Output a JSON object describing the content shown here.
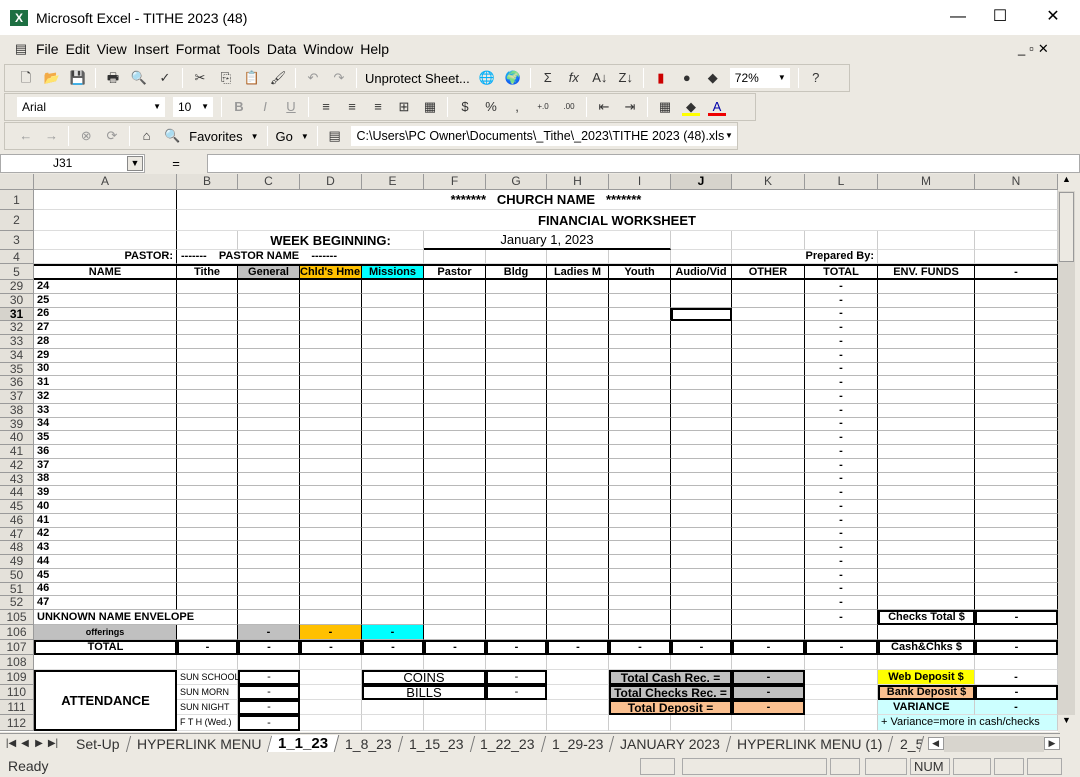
{
  "window": {
    "title": "Microsoft Excel - TITHE 2023 (48)",
    "minimize": "—",
    "maximize": "☐",
    "close": "✕"
  },
  "menu": {
    "items": [
      "File",
      "Edit",
      "View",
      "Insert",
      "Format",
      "Tools",
      "Data",
      "Window",
      "Help"
    ]
  },
  "toolbar": {
    "unprotect_label": "Unprotect Sheet...",
    "zoom": "72%",
    "font": "Arial",
    "font_size": "10",
    "favorites_label": "Favorites",
    "go_label": "Go",
    "address": "C:\\Users\\PC Owner\\Documents\\_Tithe\\_2023\\TITHE 2023 (48).xls"
  },
  "formula_bar": {
    "name_box": "J31",
    "fx": "=",
    "value": ""
  },
  "colors": {
    "gray": "#c0c0c0",
    "orange": "#ffc000",
    "cyan": "#00ffff",
    "yellow": "#ffff00",
    "peach": "#fac090",
    "light_cyan": "#ccffff"
  },
  "sheet": {
    "columns": [
      "A",
      "B",
      "C",
      "D",
      "E",
      "F",
      "G",
      "H",
      "I",
      "J",
      "K",
      "L",
      "M",
      "N"
    ],
    "row_numbers": [
      "1",
      "2",
      "3",
      "4",
      "5",
      "29",
      "30",
      "31",
      "32",
      "33",
      "34",
      "35",
      "36",
      "37",
      "38",
      "39",
      "40",
      "41",
      "42",
      "43",
      "44",
      "45",
      "46",
      "47",
      "48",
      "49",
      "50",
      "51",
      "52",
      "105",
      "106",
      "107",
      "108",
      "109",
      "110",
      "111",
      "112"
    ],
    "selected_cell": "J31",
    "cells": {
      "B1": "*******   CHURCH NAME   *******",
      "B2": "FINANCIAL WORKSHEET",
      "C3": "WEEK BEGINNING:",
      "F3": "January 1, 2023",
      "A4": "PASTOR:",
      "B4": "-------    PASTOR NAME    -------",
      "K4": "Prepared By:",
      "A5": "NAME",
      "B5": "Tithe",
      "C5": "General",
      "D5": "Chld's Hme",
      "E5": "Missions",
      "F5": "Pastor",
      "G5": "Bldg",
      "H5": "Ladies M",
      "I5": "Youth",
      "J5": "Audio/Vid",
      "K5": "OTHER",
      "L5": "TOTAL",
      "M5": "ENV. FUNDS",
      "N5": "-",
      "A29": "24",
      "A30": "25",
      "A31": "26",
      "A32": "27",
      "A33": "28",
      "A34": "29",
      "A35": "30",
      "A36": "31",
      "A37": "32",
      "A38": "33",
      "A39": "34",
      "A40": "35",
      "A41": "36",
      "A42": "37",
      "A43": "38",
      "A44": "39",
      "A45": "40",
      "A46": "41",
      "A47": "42",
      "A48": "43",
      "A49": "44",
      "A50": "45",
      "A51": "46",
      "A52": "47",
      "L29": "-",
      "L30": "-",
      "L31": "-",
      "L32": "-",
      "L33": "-",
      "L34": "-",
      "L35": "-",
      "L36": "-",
      "L37": "-",
      "L38": "-",
      "L39": "-",
      "L40": "-",
      "L41": "-",
      "L42": "-",
      "L43": "-",
      "L44": "-",
      "L45": "-",
      "L46": "-",
      "L47": "-",
      "L48": "-",
      "L49": "-",
      "L50": "-",
      "L51": "-",
      "L52": "-",
      "A105": "UNKNOWN NAME ENVELOPE",
      "L105": "-",
      "M105": "Checks Total $",
      "N105": "-",
      "A106": "offerings",
      "C106": "-",
      "D106": "-",
      "E106": "-",
      "A107": "TOTAL",
      "B107": "-",
      "C107": "-",
      "D107": "-",
      "E107": "-",
      "F107": "-",
      "G107": "-",
      "H107": "-",
      "I107": "-",
      "J107": "-",
      "K107": "-",
      "L107": "-",
      "M107": "Cash&Chks $",
      "N107": "-",
      "A109": "ATTENDANCE",
      "B109": "SUN SCHOOL",
      "C109": "-",
      "E109": "COINS",
      "G109": "-",
      "I109": "Total Cash Rec. =",
      "K109": "-",
      "M109": "Web Deposit $",
      "N109": "-",
      "B110": "SUN MORN",
      "C110": "-",
      "E110": "BILLS",
      "G110": "-",
      "I110": "Total Checks Rec. =",
      "K110": "-",
      "M110": "Bank Deposit $",
      "N110": "-",
      "B111": "SUN NIGHT",
      "C111": "-",
      "I111": "Total Deposit =",
      "K111": "-",
      "M111": "VARIANCE",
      "N111": "-",
      "B112": "F T H (Wed.)",
      "C112": "-",
      "M112": "+ Variance=more in cash/checks"
    }
  },
  "tabs": {
    "items": [
      "Set-Up",
      "HYPERLINK MENU",
      "1_1_23",
      "1_8_23",
      "1_15_23",
      "1_22_23",
      "1_29-23",
      "JANUARY 2023",
      "HYPERLINK MENU (1)",
      "2_5"
    ],
    "active": "1_1_23"
  },
  "status": {
    "text": "Ready",
    "num": "NUM"
  }
}
